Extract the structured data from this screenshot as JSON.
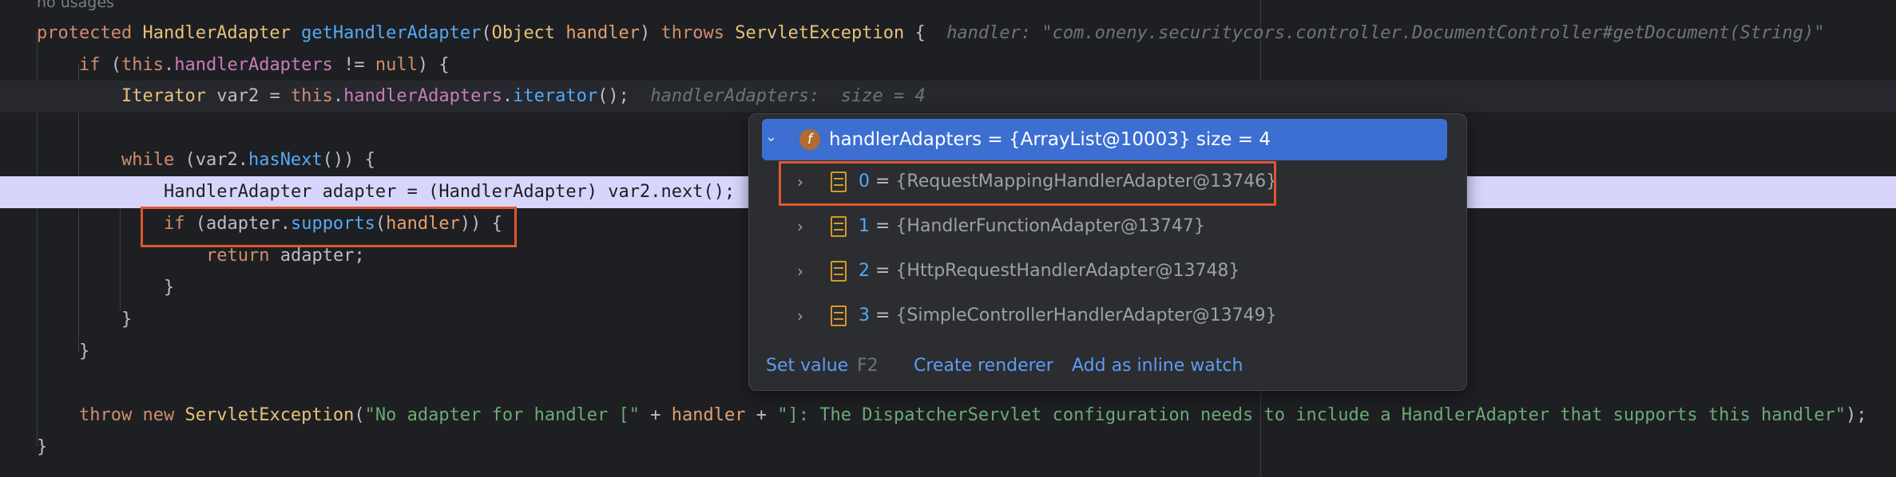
{
  "editor": {
    "usages_hint": "no usages",
    "lines": {
      "l1": {
        "protected": "protected",
        "ret_type": "HandlerAdapter",
        "method": "getHandlerAdapter",
        "open": "(",
        "param_type": "Object",
        "param": "handler",
        "close": ")",
        "throws": "throws",
        "exc": "ServletException",
        "brace": "{",
        "hint": "handler: \"com.oneny.securitycors.controller.DocumentController#getDocument(String)\""
      },
      "l2": {
        "if": "if",
        "open": " (",
        "this": "this",
        "dot": ".",
        "field": "handlerAdapters",
        "rest": " != ",
        "null": "null",
        "close": ") {"
      },
      "l3": {
        "type": "Iterator",
        "var": " var2 = ",
        "this": "this",
        "dot": ".",
        "field": "handlerAdapters",
        "dot2": ".",
        "call": "iterator",
        "end": "();",
        "hint": "handlerAdapters:  size = 4"
      },
      "l5": {
        "while": "while",
        "open": " (var2.",
        "call": "hasNext",
        "end": "()) {"
      },
      "l6": {
        "text": "HandlerAdapter adapter = (HandlerAdapter) var2.next();"
      },
      "l7": {
        "if": "if",
        "open": " (adapter.",
        "call": "supports",
        "paren": "(",
        "param": "handler",
        "end": ")) {"
      },
      "l8": {
        "return": "return",
        "rest": " adapter;"
      },
      "l9": {
        "text": "}"
      },
      "l10": {
        "text": "}"
      },
      "l11": {
        "text": "}"
      },
      "l13": {
        "throw": "throw",
        "new": "new",
        "exc": "ServletException",
        "open": "(",
        "s1": "\"No adapter for handler [\"",
        "plus1": " + ",
        "param": "handler",
        "plus2": " + ",
        "s2": "\"]: The DispatcherServlet configuration needs to include a HandlerAdapter that supports this handler\"",
        "end": ");"
      },
      "l14": {
        "text": "}"
      }
    }
  },
  "debugger_popup": {
    "field_icon": "f",
    "header": "handlerAdapters = {ArrayList@10003}  size = 4",
    "children": [
      {
        "index": "0",
        "eq": " = ",
        "value": "{RequestMappingHandlerAdapter@13746}"
      },
      {
        "index": "1",
        "eq": " = ",
        "value": "{HandlerFunctionAdapter@13747}"
      },
      {
        "index": "2",
        "eq": " = ",
        "value": "{HttpRequestHandlerAdapter@13748}"
      },
      {
        "index": "3",
        "eq": " = ",
        "value": "{SimpleControllerHandlerAdapter@13749}"
      }
    ],
    "footer": {
      "set_value": "Set value",
      "set_value_shortcut": "F2",
      "create_renderer": "Create renderer",
      "add_inline_watch": "Add as inline watch"
    }
  },
  "colors": {
    "background": "#1e1f22",
    "current_line": "#2b2d30",
    "execution_line": "#d7d5fc",
    "selected_node": "#3c6fd1",
    "highlight_box": "#e0572c"
  },
  "icons": [
    "chevron-down-icon",
    "chevron-right-icon",
    "field-icon",
    "array-icon"
  ]
}
